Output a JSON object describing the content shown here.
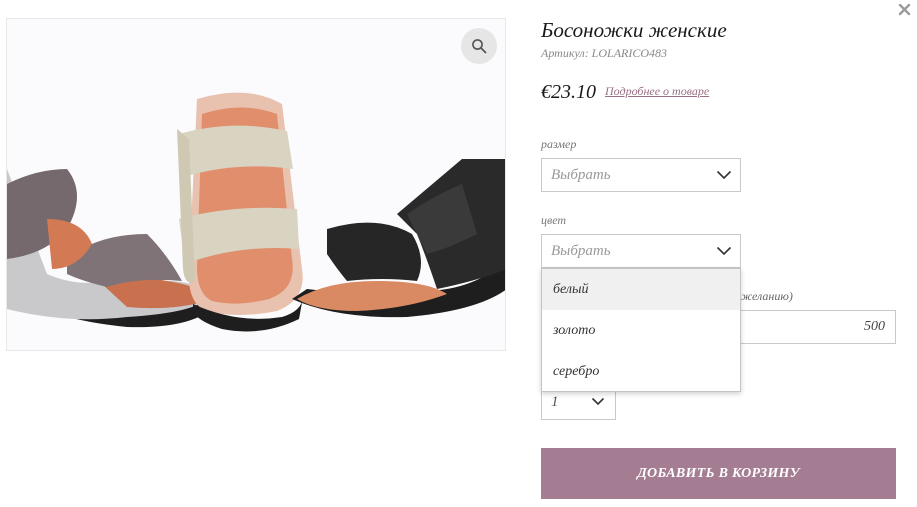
{
  "product": {
    "title": "Босоножки женские",
    "sku": "Артикул: LOLARICO483",
    "price": "€23.10",
    "details_link": "Подробнее о товаре"
  },
  "size_field": {
    "label": "размер",
    "value": "Выбрать"
  },
  "color_field": {
    "label": "цвет",
    "value": "Выбрать",
    "options": [
      "белый",
      "золото",
      "серебро"
    ],
    "highlighted_option": "белый"
  },
  "amount_field": {
    "label_partial": "желанию)",
    "value": "500"
  },
  "quantity": {
    "value": "1"
  },
  "cart_button": {
    "label": "ДОБАВИТЬ В КОРЗИНУ"
  },
  "icons": {
    "close": "close-icon",
    "zoom": "magnifier-icon",
    "chevron": "chevron-down-icon"
  },
  "colors": {
    "accent": "#a57d92",
    "link": "#9b6f86",
    "border": "#c9c9c9"
  }
}
